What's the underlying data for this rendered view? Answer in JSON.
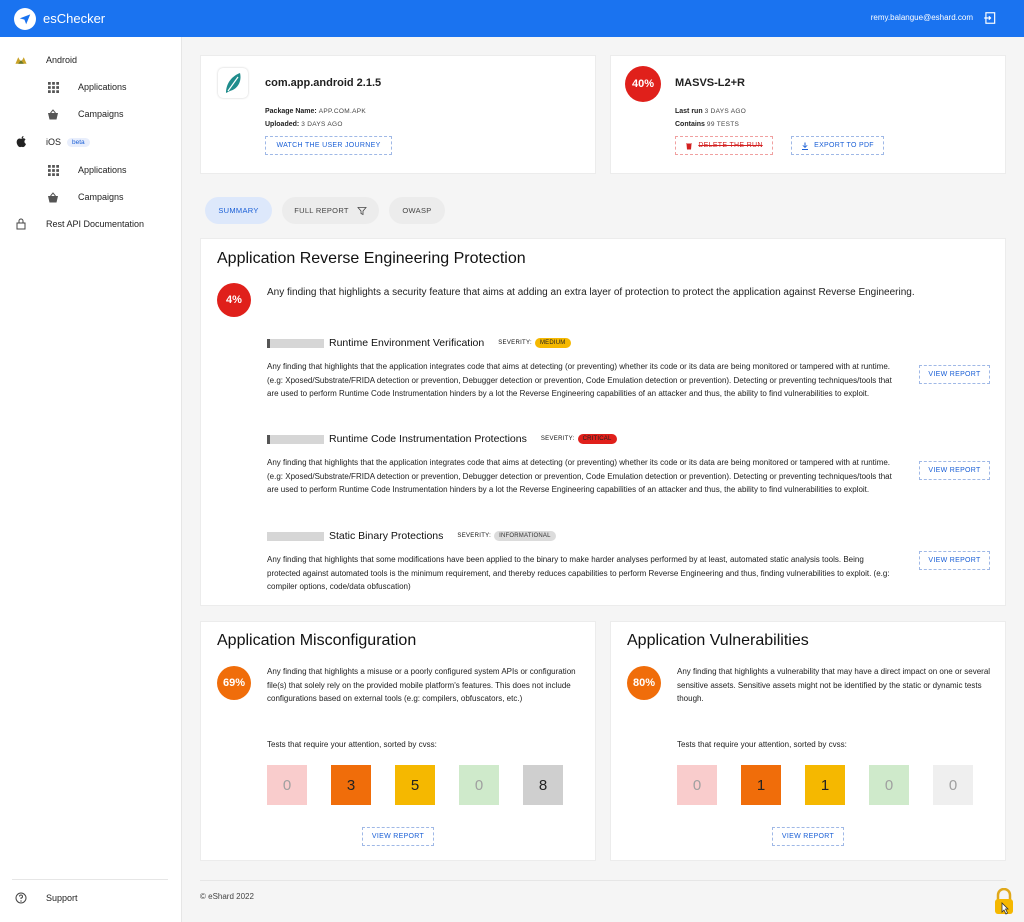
{
  "app": {
    "name": "esChecker",
    "user_email": "remy.balangue@eshard.com"
  },
  "sidebar": {
    "android": "Android",
    "android_applications": "Applications",
    "android_campaigns": "Campaigns",
    "ios": "iOS",
    "ios_badge": "beta",
    "ios_applications": "Applications",
    "ios_campaigns": "Campaigns",
    "rest_api": "Rest API Documentation",
    "support": "Support"
  },
  "app_card": {
    "title": "com.app.android 2.1.5",
    "package_label": "Package Name:",
    "package_value": "APP.COM.APK",
    "uploaded_label": "Uploaded:",
    "uploaded_value": "3 DAYS AGO",
    "journey_button": "WATCH THE USER JOURNEY"
  },
  "run_card": {
    "score": "40%",
    "title": "MASVS-L2+R",
    "last_run_label": "Last run",
    "last_run_value": "3 DAYS AGO",
    "contains_label": "Contains",
    "contains_value": "99 TESTS",
    "delete_button": "DELETE THE RUN",
    "export_button": "EXPORT TO PDF"
  },
  "tabs": {
    "summary": "SUMMARY",
    "full_report": "FULL REPORT",
    "owasp": "OWASP"
  },
  "reverse": {
    "title": "Application Reverse Engineering Protection",
    "score": "4%",
    "description": "Any finding that highlights a security feature that aims at adding an extra layer of protection to protect the application against Reverse Engineering.",
    "severity_label": "SEVERITY:",
    "items": [
      {
        "title": "Runtime Environment Verification",
        "severity": "MEDIUM",
        "description": "Any finding that highlights that the application integrates code that aims at detecting (or preventing) whether its code or its data are being monitored or tampered with at runtime. (e.g: Xposed/Substrate/FRIDA detection or prevention, Debugger detection or prevention, Code Emulation detection or prevention). Detecting or preventing techniques/tools that are used to perform Runtime Code Instrumentation hinders by a lot the Reverse Engineering capabilities of an attacker and thus, the ability to find vulnerabilities to exploit.",
        "button": "VIEW REPORT"
      },
      {
        "title": "Runtime Code Instrumentation Protections",
        "severity": "CRITICAL",
        "description": "Any finding that highlights that the application integrates code that aims at detecting (or preventing) whether its code or its data are being monitored or tampered with at runtime. (e.g: Xposed/Substrate/FRIDA detection or prevention, Debugger detection or prevention, Code Emulation detection or prevention). Detecting or preventing techniques/tools that are used to perform Runtime Code Instrumentation hinders by a lot the Reverse Engineering capabilities of an attacker and thus, the ability to find vulnerabilities to exploit.",
        "button": "VIEW REPORT"
      },
      {
        "title": "Static Binary Protections",
        "severity": "INFORMATIONAL",
        "description": "Any finding that highlights that some modifications have been applied to the binary to make harder analyses performed by at least, automated static analysis tools. Being protected against automated tools is the minimum requirement, and thereby reduces capabilities to perform Reverse Engineering and thus, finding vulnerabilities to exploit. (e.g: compiler options, code/data obfuscation)",
        "button": "VIEW REPORT"
      }
    ]
  },
  "misconfig": {
    "title": "Application Misconfiguration",
    "score": "69%",
    "description": "Any finding that highlights a misuse or a poorly configured system APIs or configuration file(s) that solely rely on the provided mobile platform's features. This does not include configurations based on external tools (e.g: compilers, obfuscators, etc.)",
    "tests_label": "Tests that require your attention, sorted by cvss:",
    "counts": [
      "0",
      "3",
      "5",
      "0",
      "8"
    ],
    "button": "VIEW REPORT"
  },
  "vulns": {
    "title": "Application Vulnerabilities",
    "score": "80%",
    "description": "Any finding that highlights a vulnerability that may have a direct impact on one or several sensitive assets. Sensitive assets might not be identified by the static or dynamic tests though.",
    "tests_label": "Tests that require your attention, sorted by cvss:",
    "counts": [
      "0",
      "1",
      "1",
      "0",
      "0"
    ],
    "button": "VIEW REPORT"
  },
  "footer": {
    "copyright": "© eShard 2022"
  },
  "colors": {
    "primary": "#1a73f0",
    "critical": "#e0201b",
    "high": "#f06d0a",
    "medium": "#f5b800",
    "low": "#cfeacb",
    "none": "#cfcfcf"
  },
  "icons": [
    "send-icon",
    "logout-icon",
    "android-icon",
    "grid-icon",
    "basket-icon",
    "apple-icon",
    "lock-icon",
    "help-icon",
    "filter-icon",
    "trash-icon",
    "download-icon",
    "app-leaf-icon",
    "padlock-cursor-icon"
  ]
}
